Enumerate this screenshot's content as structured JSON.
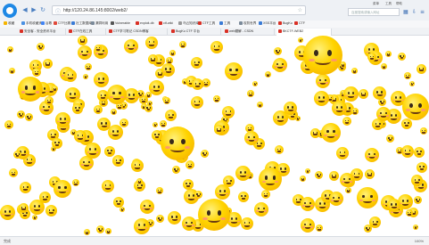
{
  "browser": {
    "address_url": "http://120.24.86.145:8002/web2/",
    "top_menu": [
      "菜单",
      "工具",
      "帮助"
    ],
    "search_placeholder": "百度搜索或输入网址"
  },
  "bookmarks": [
    {
      "label": "收藏",
      "color": "#f5b400"
    },
    {
      "label": "手机收藏夹",
      "color": "#4a90e2"
    },
    {
      "label": "谷歌",
      "color": "#4285f4"
    },
    {
      "label": "CTF比赛",
      "color": "#e04b3b"
    },
    {
      "label": "社工数据库",
      "color": "#3a7bd5"
    },
    {
      "label": "漏洞利用",
      "color": "#7b8a9a"
    },
    {
      "label": "Vulnerable",
      "color": "#555555"
    },
    {
      "label": "exploit-db",
      "color": "#d93025"
    },
    {
      "label": "ctf-wiki",
      "color": "#d93025"
    },
    {
      "label": "乌云知识库",
      "color": "#999999"
    },
    {
      "label": "CTF工具",
      "color": "#d93025"
    },
    {
      "label": "工具",
      "color": "#3a7bd5"
    },
    {
      "label": "攻防世界",
      "color": "#7b8a9a"
    },
    {
      "label": "XSS平台",
      "color": "#3a7bd5"
    },
    {
      "label": "BugKu",
      "color": "#d93025"
    },
    {
      "label": "CTF",
      "color": "#d93025"
    }
  ],
  "tabs": [
    {
      "label": "安全客 - 安全资讯平台"
    },
    {
      "label": "CTF在线工具"
    },
    {
      "label": "CTF学习笔记 CSDN博客"
    },
    {
      "label": "BugKu CTF 平台"
    },
    {
      "label": "web题解 - CSDN"
    },
    {
      "label": "BKCTF-WEB2",
      "active": true
    }
  ],
  "status": {
    "left": "完成",
    "right": "100%"
  },
  "colors": {
    "chrome_bg": "#eef1f5",
    "accent": "#1e88e5",
    "emoji_yellow": "#ffd400"
  }
}
